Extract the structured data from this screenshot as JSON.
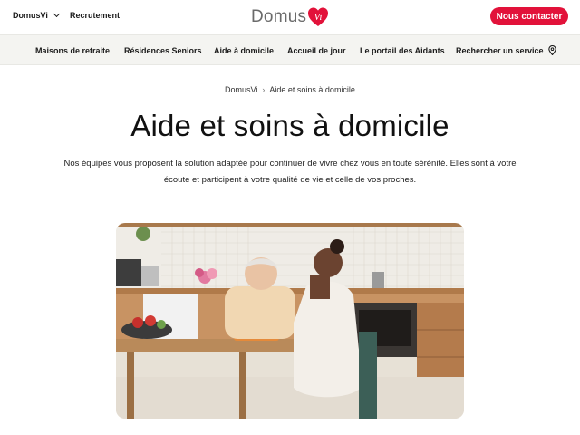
{
  "topbar": {
    "brand_switch": "DomusVi",
    "recruitment": "Recrutement",
    "logo_text": "Domus",
    "logo_mark": "Vi",
    "contact_button": "Nous contacter"
  },
  "nav": {
    "items": [
      {
        "label": "Maisons de retraite"
      },
      {
        "label": "Résidences Seniors"
      },
      {
        "label": "Aide à domicile"
      },
      {
        "label": "Accueil de jour"
      },
      {
        "label": "Le portail des Aidants"
      },
      {
        "label": "Rechercher un service"
      }
    ]
  },
  "breadcrumb": {
    "home": "DomusVi",
    "separator": "›",
    "current": "Aide et soins à domicile"
  },
  "page": {
    "title": "Aide et soins à domicile",
    "intro_line1": "Nos équipes vous proposent la solution adaptée pour continuer de vivre chez vous en toute sérénité. Elles sont à votre",
    "intro_line2": "écoute et participent à votre qualité de vie et celle de vos proches."
  },
  "colors": {
    "brand_red": "#e2123a",
    "nav_bg": "#f4f4f1"
  },
  "icons": {
    "brand_chevron": "chevron-down-icon",
    "search_service": "location-pin-icon"
  }
}
